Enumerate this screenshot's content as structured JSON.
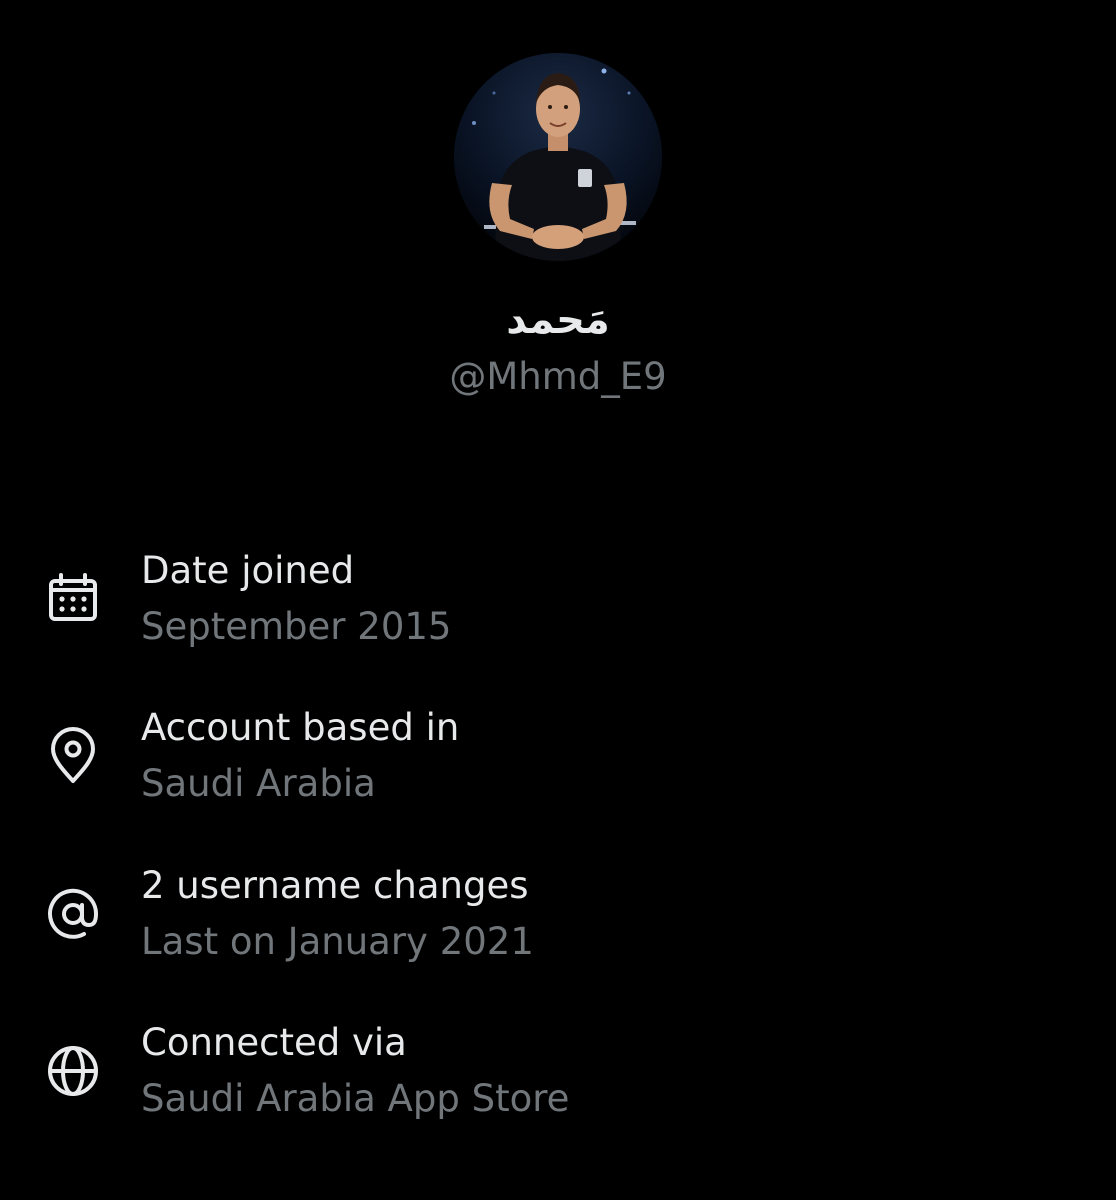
{
  "profile": {
    "display_name": "مَحمد",
    "handle": "@Mhmd_E9",
    "avatar_icon": "profile-photo"
  },
  "about": {
    "items": [
      {
        "icon": "calendar-icon",
        "title": "Date joined",
        "value": "September 2015"
      },
      {
        "icon": "location-pin-icon",
        "title": "Account based in",
        "value": "Saudi Arabia"
      },
      {
        "icon": "at-sign-icon",
        "title": "2 username changes",
        "value": "Last on January 2021"
      },
      {
        "icon": "globe-icon",
        "title": "Connected via",
        "value": "Saudi Arabia App Store"
      }
    ]
  },
  "colors": {
    "background": "#000000",
    "primary_text": "#e7e9ea",
    "secondary_text": "#71767b"
  }
}
